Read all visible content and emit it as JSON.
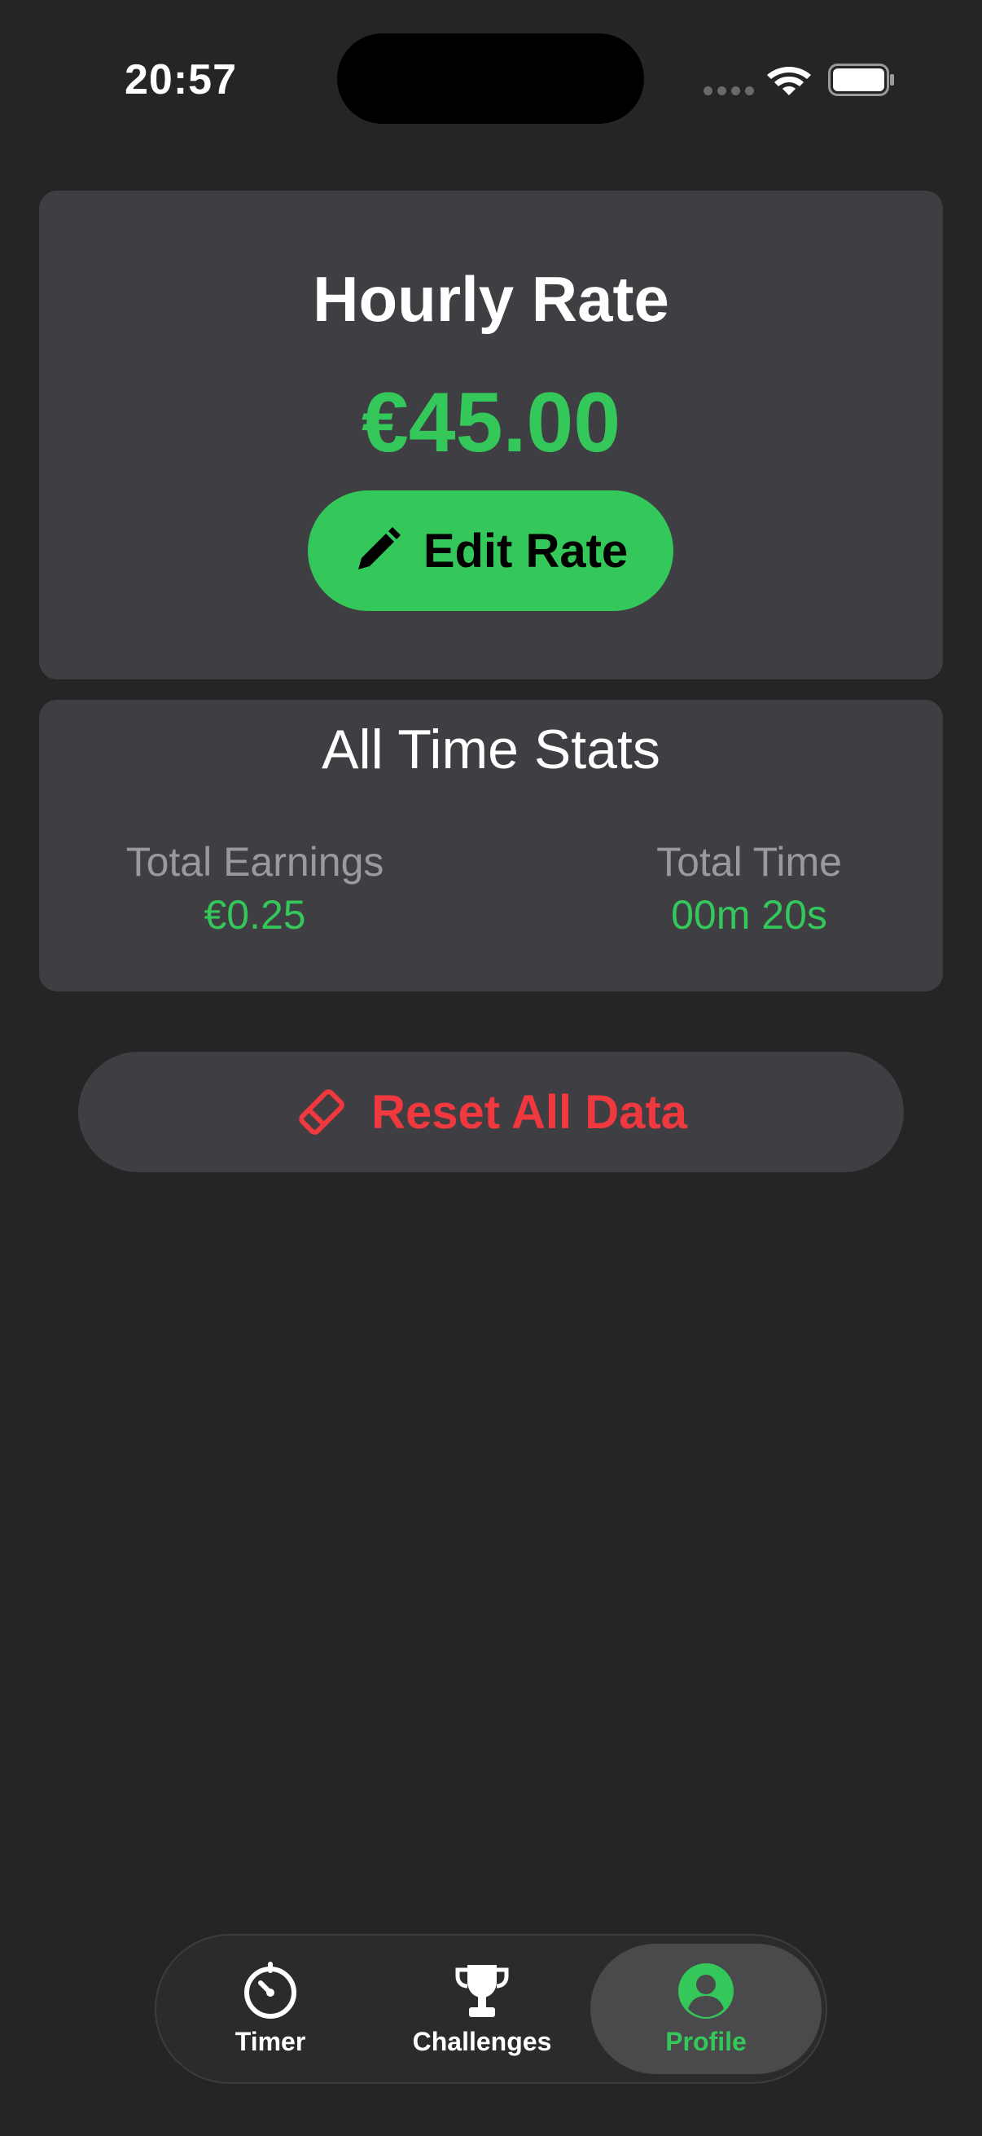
{
  "status_bar": {
    "time": "20:57"
  },
  "rate_card": {
    "title": "Hourly Rate",
    "value": "€45.00",
    "edit_button_label": "Edit Rate"
  },
  "stats_card": {
    "title": "All Time Stats",
    "total_earnings_label": "Total Earnings",
    "total_earnings_value": "€0.25",
    "total_time_label": "Total Time",
    "total_time_value": "00m 20s"
  },
  "reset_button_label": "Reset All Data",
  "tab_bar": {
    "tabs": [
      {
        "label": "Timer",
        "icon": "timer-icon"
      },
      {
        "label": "Challenges",
        "icon": "trophy-icon"
      },
      {
        "label": "Profile",
        "icon": "person-circle-icon"
      }
    ],
    "selected": "Profile"
  },
  "colors": {
    "background": "#252525",
    "card": "#3e3e43",
    "accent_green": "#34c759",
    "destructive_red": "#f0383f",
    "secondary_text": "#9a9a9e"
  }
}
